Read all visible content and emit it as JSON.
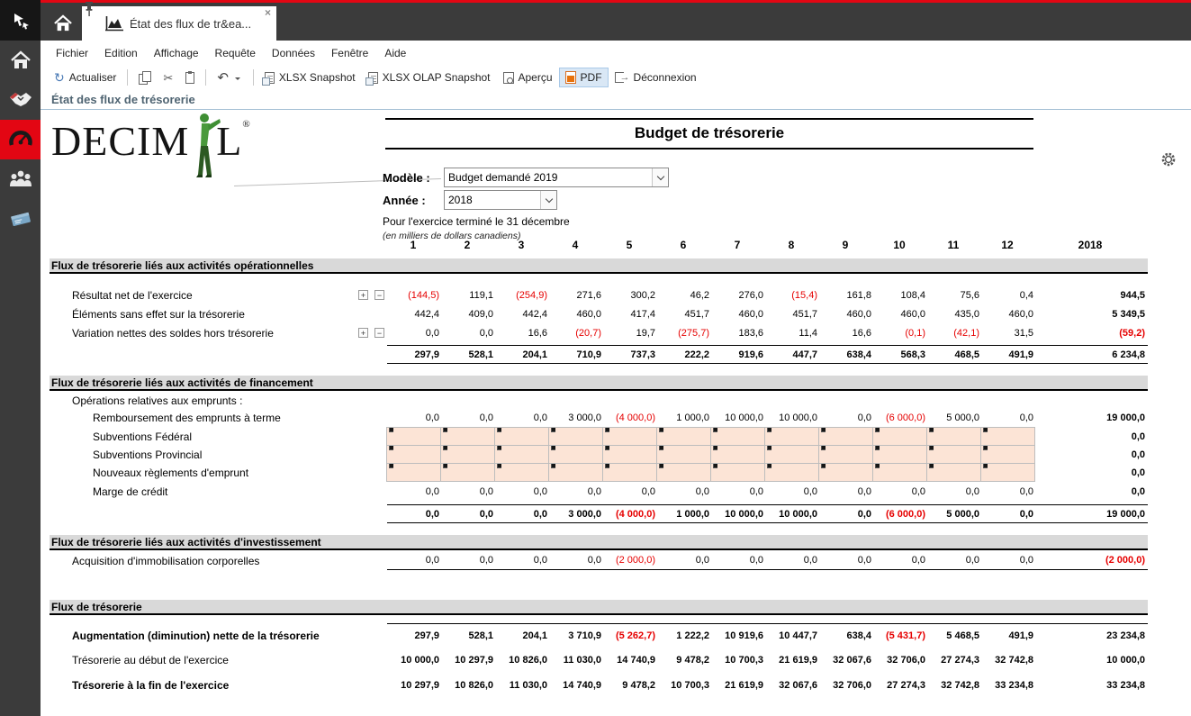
{
  "app": {
    "tab_title": "État des flux de tr&ea...",
    "tab_close": "×",
    "menu": [
      "Fichier",
      "Edition",
      "Affichage",
      "Requête",
      "Données",
      "Fenêtre",
      "Aide"
    ],
    "toolbar": {
      "actualiser": "Actualiser",
      "xlsx_snapshot": "XLSX Snapshot",
      "xlsx_olap_snapshot": "XLSX OLAP Snapshot",
      "apercu": "Aperçu",
      "pdf": "PDF",
      "deconnexion": "Déconnexion"
    },
    "breadcrumb": "État des flux de trésorerie"
  },
  "report": {
    "logo_part1": "DECIM",
    "logo_part2": "L",
    "logo_reg": "®",
    "title": "Budget de trésorerie",
    "model_label": "Modèle :",
    "model_value": "Budget demandé 2019",
    "year_label": "Année :",
    "year_value": "2018",
    "period_line": "Pour l'exercice terminé le 31 décembre",
    "units_line": "(en milliers de dollars canadiens)"
  },
  "table": {
    "expand_plus": "+",
    "expand_minus": "−",
    "columns": [
      "1",
      "2",
      "3",
      "4",
      "5",
      "6",
      "7",
      "8",
      "9",
      "10",
      "11",
      "12"
    ],
    "annual_column": "2018",
    "sections": [
      {
        "title": "Flux de trésorerie liés aux activités opérationnelles",
        "mt": 5,
        "rows": [
          {
            "type": "data",
            "mt": 13,
            "label": "Résultat net de l'exercice",
            "indent": 1,
            "expand": true,
            "values": [
              "(144,5)",
              "119,1",
              "(254,9)",
              "271,6",
              "300,2",
              "46,2",
              "276,0",
              "(15,4)",
              "161,8",
              "108,4",
              "75,6",
              "0,4"
            ],
            "annual": "944,5"
          },
          {
            "type": "data",
            "label": "Éléments sans effet sur la trésorerie",
            "indent": 1,
            "values": [
              "442,4",
              "409,0",
              "442,4",
              "460,0",
              "417,4",
              "451,7",
              "460,0",
              "451,7",
              "460,0",
              "460,0",
              "435,0",
              "460,0"
            ],
            "annual": "5 349,5"
          },
          {
            "type": "data",
            "label": "Variation nettes des soldes hors trésorerie",
            "indent": 1,
            "expand": true,
            "values": [
              "0,0",
              "0,0",
              "16,6",
              "(20,7)",
              "19,7",
              "(275,7)",
              "183,6",
              "11,4",
              "16,6",
              "(0,1)",
              "(42,1)",
              "31,5"
            ],
            "annual": "(59,2)"
          },
          {
            "type": "total",
            "mt": 3,
            "label": "",
            "values": [
              "297,9",
              "528,1",
              "204,1",
              "710,9",
              "737,3",
              "222,2",
              "919,6",
              "447,7",
              "638,4",
              "568,3",
              "468,5",
              "491,9"
            ],
            "annual": "6 234,8"
          }
        ]
      },
      {
        "title": "Flux de trésorerie liés aux activités de financement",
        "mt": 13,
        "rows": [
          {
            "type": "labelOnly",
            "mt": 3,
            "h": 16,
            "label": "Opérations relatives aux emprunts :",
            "indent": 1
          },
          {
            "type": "data",
            "label": "Remboursement des emprunts à terme",
            "indent": 2,
            "values": [
              "0,0",
              "0,0",
              "0,0",
              "3 000,0",
              "(4 000,0)",
              "1 000,0",
              "10 000,0",
              "10 000,0",
              "0,0",
              "(6 000,0)",
              "5 000,0",
              "0,0"
            ],
            "annual": "19 000,0"
          },
          {
            "type": "input",
            "label": "Subventions Fédéral",
            "indent": 2,
            "annual": "0,0"
          },
          {
            "type": "input",
            "label": "Subventions Provincial",
            "indent": 2,
            "annual": "0,0"
          },
          {
            "type": "input",
            "label": "Nouveaux règlements d'emprunt",
            "indent": 2,
            "annual": "0,0"
          },
          {
            "type": "data",
            "label": "Marge de crédit",
            "indent": 2,
            "values": [
              "0,0",
              "0,0",
              "0,0",
              "0,0",
              "0,0",
              "0,0",
              "0,0",
              "0,0",
              "0,0",
              "0,0",
              "0,0",
              "0,0"
            ],
            "annual": "0,0"
          },
          {
            "type": "total",
            "mt": 4,
            "label": "",
            "values": [
              "0,0",
              "0,0",
              "0,0",
              "3 000,0",
              "(4 000,0)",
              "1 000,0",
              "10 000,0",
              "10 000,0",
              "0,0",
              "(6 000,0)",
              "5 000,0",
              "0,0"
            ],
            "annual": "19 000,0"
          }
        ]
      },
      {
        "title": "Flux de trésorerie liés aux activités d'investissement",
        "mt": 13,
        "rows": [
          {
            "type": "data",
            "mt": 1,
            "label": "Acquisition d'immobilisation corporelles",
            "indent": 1,
            "underline": true,
            "values": [
              "0,0",
              "0,0",
              "0,0",
              "0,0",
              "(2 000,0)",
              "0,0",
              "0,0",
              "0,0",
              "0,0",
              "0,0",
              "0,0",
              "0,0"
            ],
            "annual": "(2 000,0)"
          }
        ]
      },
      {
        "title": "Flux de trésorerie",
        "mt": 33,
        "rows": [
          {
            "type": "data",
            "mt": 9,
            "h": 27,
            "label": "Augmentation (diminution) nette de la trésorerie",
            "indent": 1,
            "bold": true,
            "valBold": true,
            "topline": true,
            "values": [
              "297,9",
              "528,1",
              "204,1",
              "3 710,9",
              "(5 262,7)",
              "1 222,2",
              "10 919,6",
              "10 447,7",
              "638,4",
              "(5 431,7)",
              "5 468,5",
              "491,9"
            ],
            "annual": "23 234,8"
          },
          {
            "type": "data",
            "h": 28,
            "label": "Trésorerie au début de l'exercice",
            "indent": 1,
            "valBold": true,
            "values": [
              "10 000,0",
              "10 297,9",
              "10 826,0",
              "11 030,0",
              "14 740,9",
              "9 478,2",
              "10 700,3",
              "21 619,9",
              "32 067,6",
              "32 706,0",
              "27 274,3",
              "32 742,8"
            ],
            "annual": "10 000,0"
          },
          {
            "type": "data",
            "h": 28,
            "label": "Trésorerie à la fin de l'exercice",
            "indent": 1,
            "bold": true,
            "valBold": true,
            "values": [
              "10 297,9",
              "10 826,0",
              "11 030,0",
              "14 740,9",
              "9 478,2",
              "10 700,3",
              "21 619,9",
              "32 067,6",
              "32 706,0",
              "27 274,3",
              "32 742,8",
              "33 234,8"
            ],
            "annual": "33 234,8"
          }
        ]
      }
    ]
  }
}
